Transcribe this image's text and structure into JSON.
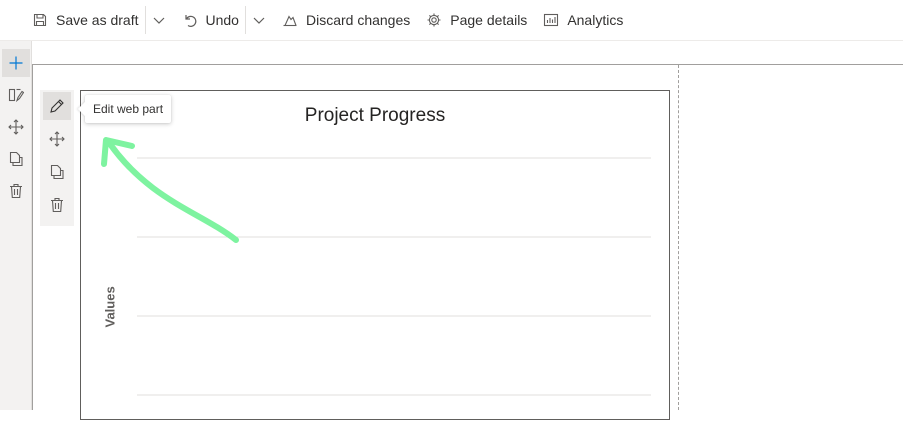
{
  "toolbar": {
    "save_label": "Save as draft",
    "undo_label": "Undo",
    "discard_label": "Discard changes",
    "page_details_label": "Page details",
    "analytics_label": "Analytics"
  },
  "rail": {
    "items": [
      {
        "name": "add-section",
        "icon": "plus-icon"
      },
      {
        "name": "edit-section",
        "icon": "section-edit-icon"
      },
      {
        "name": "move-section",
        "icon": "move-icon"
      },
      {
        "name": "duplicate-section",
        "icon": "copy-icon"
      },
      {
        "name": "delete-section",
        "icon": "trash-icon"
      }
    ]
  },
  "webpart_toolbar": {
    "items": [
      {
        "name": "edit",
        "icon": "pencil-icon"
      },
      {
        "name": "move",
        "icon": "move-icon"
      },
      {
        "name": "duplicate",
        "icon": "copy-icon"
      },
      {
        "name": "delete",
        "icon": "trash-icon"
      }
    ],
    "tooltip": "Edit web part"
  },
  "chart_data": {
    "type": "bar",
    "title": "Project Progress",
    "xlabel": "",
    "ylabel": "Values",
    "grid": true,
    "gridline_count": 4,
    "categories": [],
    "values": []
  },
  "colors": {
    "accent": "#0078d4",
    "annotation": "#7ef3a0",
    "rail_bg": "#f3f2f1",
    "gridline": "#e1dfdd"
  }
}
